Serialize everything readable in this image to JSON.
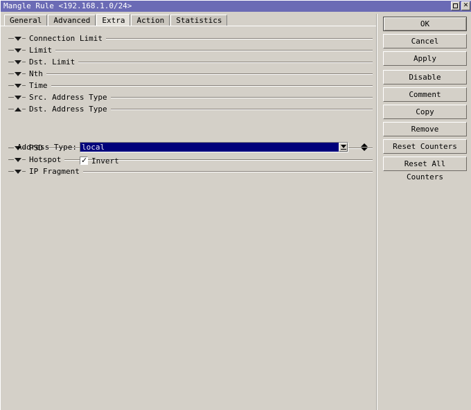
{
  "window": {
    "title": "Mangle Rule <192.168.1.0/24>",
    "controls": [
      {
        "name": "maximize-button",
        "glyph": "square"
      },
      {
        "name": "close-button",
        "glyph": "×"
      }
    ]
  },
  "tabs": [
    {
      "label": "General",
      "active": false
    },
    {
      "label": "Advanced",
      "active": false
    },
    {
      "label": "Extra",
      "active": true
    },
    {
      "label": "Action",
      "active": false
    },
    {
      "label": "Statistics",
      "active": false
    }
  ],
  "sections": [
    {
      "label": "Connection Limit",
      "expanded": false
    },
    {
      "label": "Limit",
      "expanded": false
    },
    {
      "label": "Dst. Limit",
      "expanded": false
    },
    {
      "label": "Nth",
      "expanded": false
    },
    {
      "label": "Time",
      "expanded": false
    },
    {
      "label": "Src. Address Type",
      "expanded": false
    },
    {
      "label": "Dst. Address Type",
      "expanded": true
    },
    {
      "label": "PSD",
      "expanded": false
    },
    {
      "label": "Hotspot",
      "expanded": false
    },
    {
      "label": "IP Fragment",
      "expanded": false
    }
  ],
  "field": {
    "label": "Address Type:",
    "value": "local",
    "dropdown_icon": "chevron-down-icon",
    "spinner_icon": "up-down-arrows-icon"
  },
  "checkbox": {
    "label": "Invert",
    "checked": true
  },
  "buttons": [
    {
      "label": "OK",
      "default": true,
      "gap_above": false
    },
    {
      "label": "Cancel",
      "default": false,
      "gap_above": false
    },
    {
      "label": "Apply",
      "default": false,
      "gap_above": false
    },
    {
      "label": "Disable",
      "default": false,
      "gap_above": true
    },
    {
      "label": "Comment",
      "default": false,
      "gap_above": false
    },
    {
      "label": "Copy",
      "default": false,
      "gap_above": false
    },
    {
      "label": "Remove",
      "default": false,
      "gap_above": false
    },
    {
      "label": "Reset Counters",
      "default": false,
      "gap_above": false
    },
    {
      "label": "Reset All Counters",
      "default": false,
      "gap_above": false
    }
  ],
  "colors": {
    "titlebar": "#6b6bb5",
    "window_bg": "#d4d0c8",
    "selection_bg": "#00007b",
    "selection_fg": "#e8e8f4"
  }
}
